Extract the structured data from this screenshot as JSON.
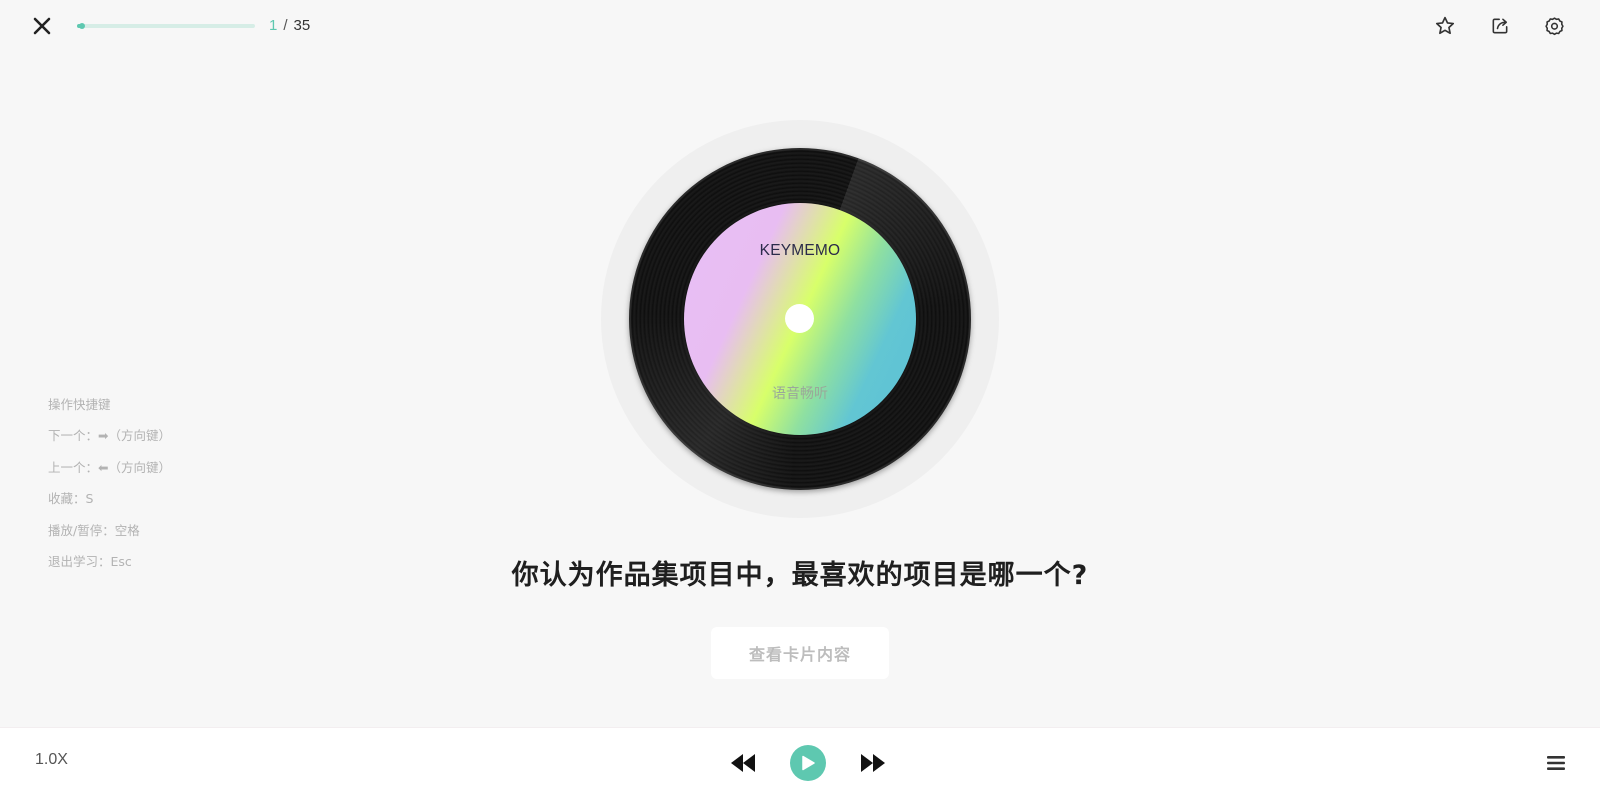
{
  "header": {
    "progress": {
      "current": "1",
      "separator": "/",
      "total": "35",
      "fraction": 0.0286
    },
    "icons": {
      "close": "close-icon",
      "favorite": "star-icon",
      "share": "share-icon",
      "settings": "gear-icon"
    }
  },
  "shortcuts": {
    "title": "操作快捷键",
    "items": [
      {
        "label": "下一个：➡（方向键）"
      },
      {
        "label": "上一个：⬅（方向键）"
      },
      {
        "label": "收藏：S"
      },
      {
        "label": "播放/暂停：空格"
      },
      {
        "label": "退出学习：Esc"
      }
    ]
  },
  "disc": {
    "label_title": "KEYMEMO",
    "label_subtitle": "语音畅听"
  },
  "card": {
    "question": "你认为作品集项目中，最喜欢的项目是哪一个?",
    "reveal_button": "查看卡片内容"
  },
  "player": {
    "speed": "1.0X",
    "accent_color": "#5ec8b0",
    "icons": {
      "previous": "rewind-icon",
      "play": "play-icon",
      "next": "fast-forward-icon",
      "menu": "menu-icon"
    }
  }
}
